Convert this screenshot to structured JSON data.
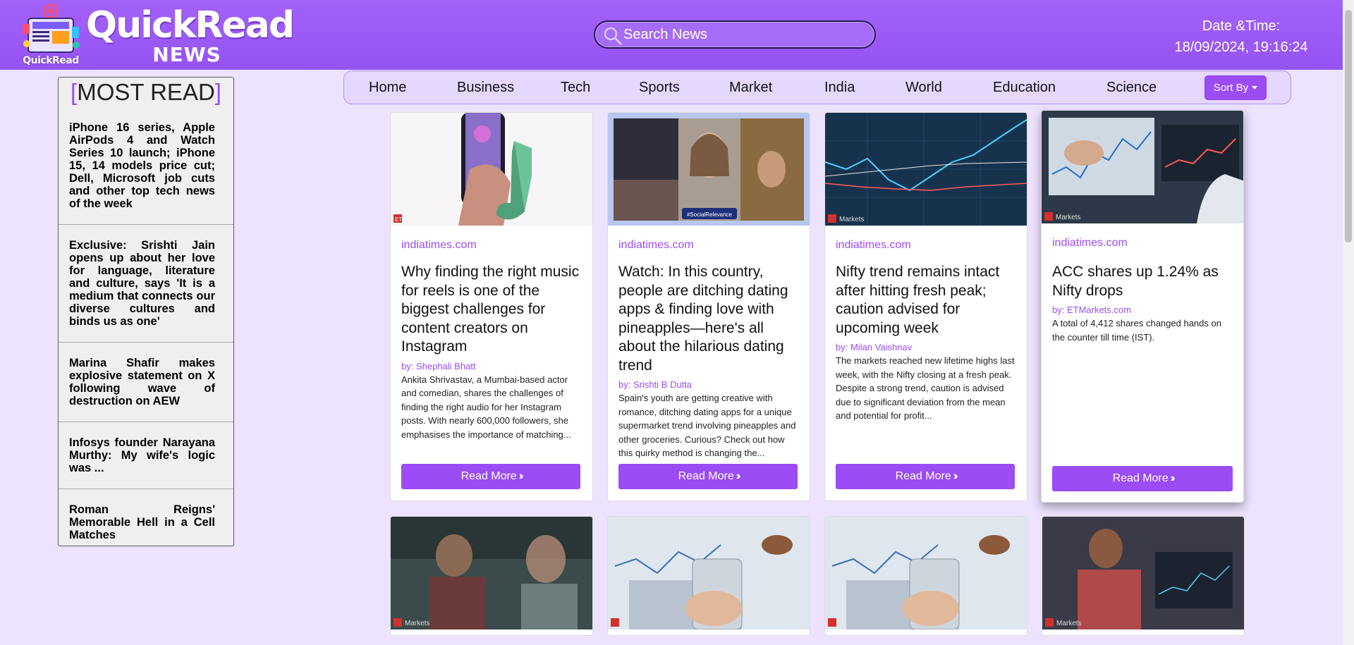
{
  "header": {
    "logo_title": "QuickRead",
    "logo_sub": "NEWS",
    "logo_badge": "QuickRead",
    "search_placeholder": "Search News",
    "datetime_label": "Date &Time:",
    "datetime_value": "18/09/2024, 19:16:24"
  },
  "sidebar": {
    "title": "MOST READ",
    "items": [
      "iPhone 16 series, Apple AirPods 4 and Watch Series 10 launch; iPhone 15, 14 models price cut; Dell, Microsoft job cuts and other top tech news of the week",
      "Exclusive: Srishti Jain opens up about her love for language, literature and culture, says 'It is a medium that connects our diverse cultures and binds us as one'",
      "Marina Shafir makes explosive statement on X following wave of destruction on AEW",
      "Infosys founder Narayana Murthy: My wife's logic was ...",
      "Roman Reigns' Memorable Hell in a Cell Matches"
    ]
  },
  "nav": {
    "items": [
      "Home",
      "Business",
      "Tech",
      "Sports",
      "Market",
      "India",
      "World",
      "Education",
      "Science"
    ],
    "sort_label": "Sort By"
  },
  "cards": [
    {
      "source": "indiatimes.com",
      "title": "Why finding the right music for reels is one of the biggest challenges for content creators on Instagram",
      "author": "by: Shephali Bhatt",
      "desc": "Ankita Shrivastav, a Mumbai-based actor and comedian, shares the challenges of finding the right audio for her Instagram posts. With nearly 600,000 followers, she emphasises the importance of matching...",
      "button": "Read More"
    },
    {
      "source": "indiatimes.com",
      "title": "Watch: In this country, people are ditching dating apps & finding love with pineapples—here's all about the hilarious dating trend",
      "author": "by: Srishti B Dutta",
      "desc": "Spain's youth are getting creative with romance, ditching dating apps for a unique supermarket trend involving pineapples and other groceries. Curious? Check out how this quirky method is changing the...",
      "button": "Read More"
    },
    {
      "source": "indiatimes.com",
      "title": "Nifty trend remains intact after hitting fresh peak; caution advised for upcoming week",
      "author": "by: Milan Vaishnav",
      "desc": "The markets reached new lifetime highs last week, with the Nifty closing at a fresh peak. Despite a strong trend, caution is advised due to significant deviation from the mean and potential for profit...",
      "button": "Read More"
    },
    {
      "source": "indiatimes.com",
      "title": "ACC shares up 1.24% as Nifty drops",
      "author": "by: ETMarkets.com",
      "desc": "A total of 4,412 shares changed hands on the counter till time (IST).",
      "button": "Read More"
    }
  ],
  "image_text": {
    "social_relevance": "#SocialRelevance",
    "markets": "Markets",
    "et": "ET"
  },
  "colors": {
    "header": "#9b5cf6",
    "accent": "#9b4cf5",
    "page_bg": "#ede3ff"
  }
}
